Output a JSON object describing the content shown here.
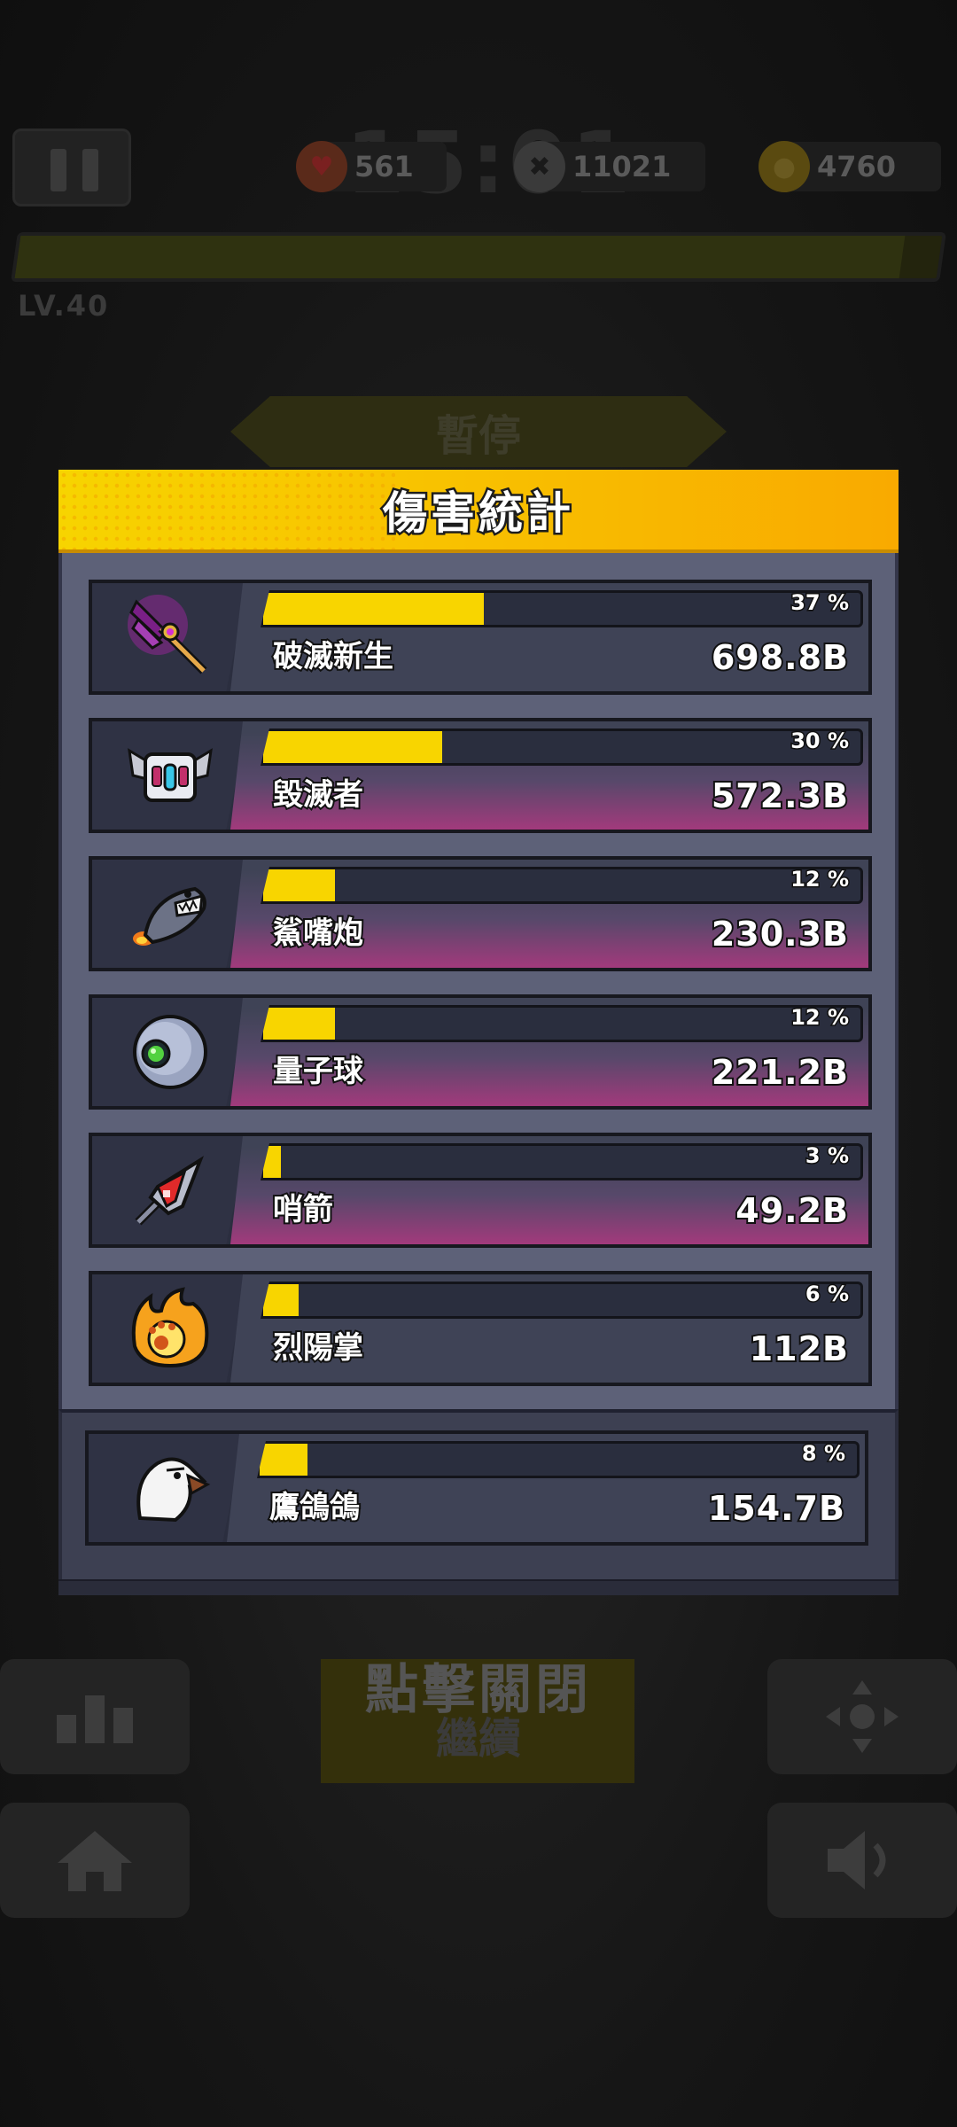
{
  "hud": {
    "hearts": "561",
    "kills": "11021",
    "coins": "4760",
    "level": "LV.40"
  },
  "pause_label": "暫停",
  "modal": {
    "title": "傷害統計",
    "weapons": [
      {
        "name": "破滅新生",
        "percent_label": "37 %",
        "damage": "698.8B",
        "fill": 0.37,
        "icon": "purple-axe-icon"
      },
      {
        "name": "毀滅者",
        "percent_label": "30 %",
        "damage": "572.3B",
        "fill": 0.3,
        "icon": "destroyer-drone-icon"
      },
      {
        "name": "鯊嘴炮",
        "percent_label": "12 %",
        "damage": "230.3B",
        "fill": 0.12,
        "icon": "shark-rocket-icon"
      },
      {
        "name": "量子球",
        "percent_label": "12 %",
        "damage": "221.2B",
        "fill": 0.12,
        "icon": "quantum-orb-icon"
      },
      {
        "name": "哨箭",
        "percent_label": "3 %",
        "damage": "49.2B",
        "fill": 0.03,
        "icon": "whistle-arrow-icon"
      },
      {
        "name": "烈陽掌",
        "percent_label": "6 %",
        "damage": "112B",
        "fill": 0.06,
        "icon": "flame-paw-icon"
      }
    ],
    "companion": {
      "name": "鷹鴿鴿",
      "percent_label": "8 %",
      "damage": "154.7B",
      "fill": 0.08,
      "icon": "eagle-pigeon-icon"
    }
  },
  "close_prompt": "點擊關閉",
  "continue_label": "繼續"
}
